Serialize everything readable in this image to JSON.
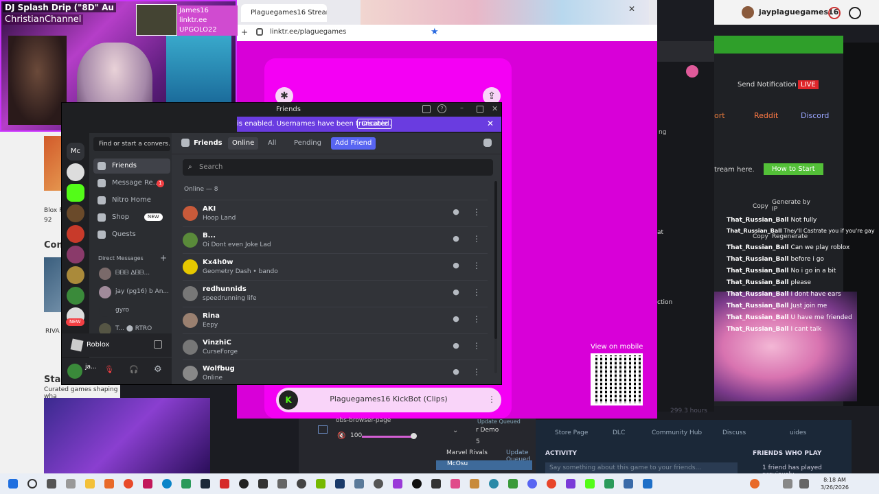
{
  "topbar": {
    "username": "jayplaguegames16"
  },
  "webcam": {
    "title": "DJ Splash Drip (\"8D\" Au",
    "channel": "ChristianChannel",
    "tag": "James16 linktr.ee UPGOLO22"
  },
  "leftbg": {
    "item1": "Blox F",
    "item1b": "92",
    "heading": "Con",
    "item2": "RIVA",
    "item3": "Star",
    "item3b": "Curated games shaping wha"
  },
  "browser": {
    "tab_title": "Plaguegames16 Stream - Watch",
    "url": "linktr.ee/plaguegames",
    "kickbot": "Plaguegames16 KickBot (Clips)",
    "view_on_mobile": "View on mobile"
  },
  "green": {
    "send_notification": "Send Notification",
    "live": "LIVE",
    "reddit": "Reddit",
    "discord": "Discord",
    "port": "ort",
    "stream_here": "tream here.",
    "how_to_start": "How to Start",
    "copy": "Copy",
    "generate_by_ip": "Generate by IP",
    "regenerate": "Regenerate",
    "at": "at",
    "ction": "ction",
    "ng": "ng"
  },
  "chat": {
    "messages": [
      {
        "user": "That_Russian_Ball",
        "text": "Not fully"
      },
      {
        "user": "That_Russian_Ball",
        "text": "They'll Castrate you if you're gay"
      },
      {
        "user": "That_Russian_Ball",
        "text": "Can we play roblox"
      },
      {
        "user": "That_Russian_Ball",
        "text": "before i go"
      },
      {
        "user": "That_Russian_Ball",
        "text": "No i go in a bit"
      },
      {
        "user": "That_Russian_Ball",
        "text": "please"
      },
      {
        "user": "That_Russian_Ball",
        "text": "I dont have ears"
      },
      {
        "user": "That_Russian_Ball",
        "text": "Just join me"
      },
      {
        "user": "That_Russian_Ball",
        "text": "U have me friended"
      },
      {
        "user": "That_Russian_Ball",
        "text": "I cant talk"
      }
    ]
  },
  "obs": {
    "source": "obs-browser-page",
    "volume": "100"
  },
  "steam": {
    "store_page": "Store Page",
    "dlc": "DLC",
    "community_hub": "Community Hub",
    "discussions": "Discuss",
    "guides": "uides",
    "activity": "ACTIVITY",
    "activity_placeholder": "Say something about this game to your friends...",
    "friends_who_play": "FRIENDS WHO PLAY",
    "friends_count": "1 friend has played previously",
    "hours": "299.3 hours",
    "update1_name": "Update Queued",
    "update2": "r Demo",
    "update3": "5",
    "rivals": "Marvel Rivals",
    "rivals_status": "Update Queued",
    "mcosu": "McOsu"
  },
  "discord": {
    "window_title": "Friends",
    "notice": "is enabled. Usernames have been truncated.",
    "notice_button": "Disable",
    "find": "Find or start a convers...",
    "nav": [
      {
        "label": "Friends"
      },
      {
        "label": "Message Re...",
        "badge": "1"
      },
      {
        "label": "Nitro Home"
      },
      {
        "label": "Shop",
        "tag": "NEW"
      },
      {
        "label": "Quests"
      }
    ],
    "dm_header": "Direct Messages",
    "dms": [
      {
        "name": "ᗷᗷᗷ ᐃᗷᗷ..."
      },
      {
        "name": "jay (pg16) b An..."
      },
      {
        "name": "gyro"
      },
      {
        "name": "T... ⬤ RTRO"
      }
    ],
    "server_new": "NEW",
    "game": "Roblox",
    "user_short": "ja...",
    "tabs": {
      "friends": "Friends",
      "online": "Online",
      "all": "All",
      "pending": "Pending",
      "add": "Add Friend"
    },
    "search_placeholder": "Search",
    "online_header": "Online — 8",
    "friends": [
      {
        "name": "AKI",
        "status": "Hoop Land",
        "color": "#c85a3a"
      },
      {
        "name": "B...",
        "status": "Oi Dont even Joke Lad",
        "color": "#5a8a3a"
      },
      {
        "name": "Kx4h0w",
        "status": "Geometry Dash • bando",
        "color": "#e6c800"
      },
      {
        "name": "redhunnids",
        "status": "speedrunning life",
        "color": "#777777"
      },
      {
        "name": "Rina",
        "status": "Eepy",
        "color": "#9a8070"
      },
      {
        "name": "VinzhiC",
        "status": "CurseForge",
        "color": "#777777"
      },
      {
        "name": "Wolfbug",
        "status": "Online",
        "color": "#888888"
      }
    ]
  },
  "taskbar": {
    "time": "8:18 AM",
    "date": "3/26/2026"
  },
  "colors": {
    "discord_blurple": "#5865f2",
    "linktree_magenta": "#f400f4",
    "kick_green": "#53fc18"
  }
}
